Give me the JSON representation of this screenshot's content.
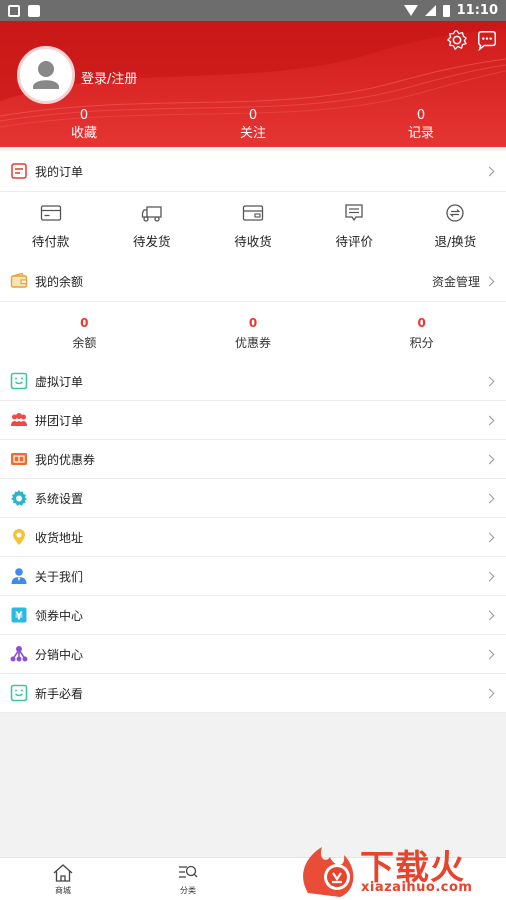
{
  "status_bar": {
    "time": "11:10"
  },
  "header": {
    "login_label": "登录/注册",
    "stats": [
      {
        "value": "0",
        "label": "收藏"
      },
      {
        "value": "0",
        "label": "关注"
      },
      {
        "value": "0",
        "label": "记录"
      }
    ]
  },
  "orders": {
    "title": "我的订单",
    "items": [
      {
        "label": "待付款",
        "icon": "wallet-card-icon"
      },
      {
        "label": "待发货",
        "icon": "truck-icon"
      },
      {
        "label": "待收货",
        "icon": "card-receive-icon"
      },
      {
        "label": "待评价",
        "icon": "comment-icon"
      },
      {
        "label": "退/换货",
        "icon": "return-exchange-icon"
      }
    ]
  },
  "balance": {
    "title": "我的余额",
    "manage_label": "资金管理",
    "items": [
      {
        "value": "0",
        "label": "余额"
      },
      {
        "value": "0",
        "label": "优惠券"
      },
      {
        "value": "0",
        "label": "积分"
      }
    ]
  },
  "menu": [
    {
      "label": "虚拟订单",
      "icon": "virtual-order-icon"
    },
    {
      "label": "拼团订单",
      "icon": "group-buy-icon"
    },
    {
      "label": "我的优惠券",
      "icon": "coupon-icon"
    },
    {
      "label": "系统设置",
      "icon": "gear-icon"
    },
    {
      "label": "收货地址",
      "icon": "location-icon"
    },
    {
      "label": "关于我们",
      "icon": "person-icon"
    },
    {
      "label": "领券中心",
      "icon": "yuan-coupon-icon"
    },
    {
      "label": "分销中心",
      "icon": "network-icon"
    },
    {
      "label": "新手必看",
      "icon": "guide-icon"
    }
  ],
  "tabbar": {
    "items": [
      {
        "label": "商城",
        "icon": "home-icon"
      },
      {
        "label": "分类",
        "icon": "category-search-icon"
      }
    ]
  },
  "watermark": {
    "title": "下载火",
    "url": "xiazaihuo.com"
  },
  "colors": {
    "brand_red": "#e53533",
    "value_red": "#e8382f"
  }
}
